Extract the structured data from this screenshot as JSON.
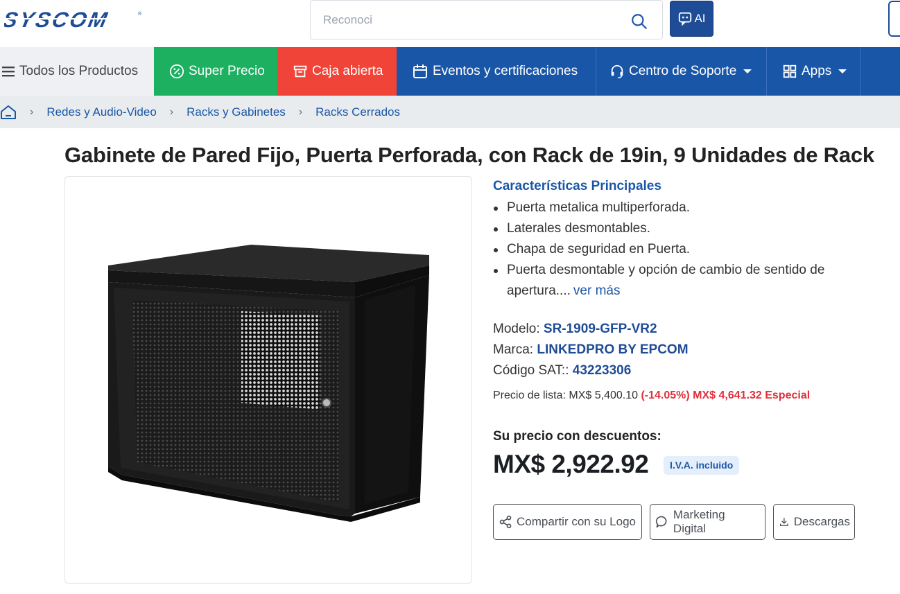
{
  "header": {
    "logo_text": "SYSCOM",
    "search_value": "Reconoci",
    "ai_label": "AI"
  },
  "nav": {
    "all_products": "Todos los Productos",
    "super_precio": "Super Precio",
    "caja_abierta": "Caja abierta",
    "eventos": "Eventos y certificaciones",
    "soporte": "Centro de Soporte",
    "apps": "Apps"
  },
  "breadcrumb": {
    "items": [
      "Redes y Audio-Video",
      "Racks y Gabinetes",
      "Racks Cerrados"
    ]
  },
  "product": {
    "title": "Gabinete de Pared Fijo, Puerta Perforada, con Rack de 19in, 9 Unidades de Rack",
    "features_title": "Características Principales",
    "features": [
      "Puerta metalica multiperforada.",
      "Laterales desmontables.",
      "Chapa de seguridad en Puerta.",
      "Puerta desmontable y opción de cambio de sentido de apertura...."
    ],
    "ver_mas": "ver más",
    "modelo_label": "Modelo:",
    "modelo": "SR-1909-GFP-VR2",
    "marca_label": "Marca:",
    "marca": "LINKEDPRO BY EPCOM",
    "sat_label": "Código SAT::",
    "sat": "43223306",
    "list_price_label": "Precio de lista: MX$ 5,400.10",
    "special_price": "(-14.05%) MX$ 4,641.32 Especial",
    "your_price_label": "Su precio con descuentos:",
    "your_price": "MX$ 2,922.92",
    "iva_badge": "I.V.A. incluido"
  },
  "actions": {
    "share": "Compartir con su Logo",
    "marketing": "Marketing Digital",
    "downloads": "Descargas"
  },
  "colors": {
    "brand_blue": "#1a56a8",
    "super_green": "#1cb060",
    "caja_red": "#f04438",
    "special_red": "#e0303a"
  }
}
